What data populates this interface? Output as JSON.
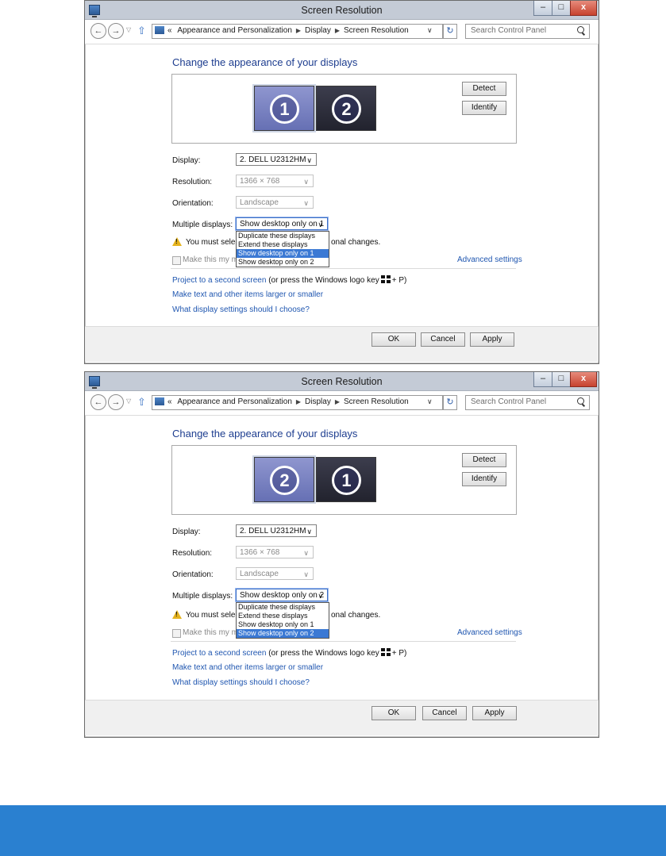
{
  "windows": [
    {
      "title": "Screen Resolution",
      "breadcrumb": [
        "«",
        "Appearance and Personalization",
        "Display",
        "Screen Resolution"
      ],
      "search_placeholder": "Search Control Panel",
      "heading": "Change the appearance of your displays",
      "monitors": [
        {
          "label": "1",
          "style": "blue",
          "selected": true
        },
        {
          "label": "2",
          "style": "dark",
          "selected": false
        }
      ],
      "buttons": {
        "detect": "Detect",
        "identify": "Identify",
        "ok": "OK",
        "cancel": "Cancel",
        "apply": "Apply"
      },
      "display_label": "Display:",
      "display_value": "2. DELL U2312HM",
      "resolution_label": "Resolution:",
      "resolution_value": "1366 × 768",
      "orientation_label": "Orientation:",
      "orientation_value": "Landscape",
      "multiple_label": "Multiple displays:",
      "multiple_value": "Show desktop only on 1",
      "dropdown_options": [
        "Duplicate these displays",
        "Extend these displays",
        "Show desktop only on 1",
        "Show desktop only on 2"
      ],
      "dropdown_selected": 2,
      "warning_text": "You must selec",
      "warning_end": "onal changes.",
      "checkbox_label": "Make this my m",
      "advanced": "Advanced settings",
      "link_project": "Project to a second screen",
      "link_project_rest_a": "(or press the Windows logo key",
      "link_project_rest_b": "+ P)",
      "link_text": "Make text and other items larger or smaller",
      "link_help": "What display settings should I choose?"
    },
    {
      "title": "Screen Resolution",
      "breadcrumb": [
        "«",
        "Appearance and Personalization",
        "Display",
        "Screen Resolution"
      ],
      "search_placeholder": "Search Control Panel",
      "heading": "Change the appearance of your displays",
      "monitors": [
        {
          "label": "2",
          "style": "blue",
          "selected": true
        },
        {
          "label": "1",
          "style": "dark",
          "selected": false
        }
      ],
      "buttons": {
        "detect": "Detect",
        "identify": "Identify",
        "ok": "OK",
        "cancel": "Cancel",
        "apply": "Apply"
      },
      "display_label": "Display:",
      "display_value": "2. DELL U2312HM",
      "resolution_label": "Resolution:",
      "resolution_value": "1366 × 768",
      "orientation_label": "Orientation:",
      "orientation_value": "Landscape",
      "multiple_label": "Multiple displays:",
      "multiple_value": "Show desktop only on 2",
      "dropdown_options": [
        "Duplicate these displays",
        "Extend these displays",
        "Show desktop only on 1",
        "Show desktop only on 2"
      ],
      "dropdown_selected": 3,
      "warning_text": "You must selec",
      "warning_end": "onal changes.",
      "checkbox_label": "Make this my m",
      "advanced": "Advanced settings",
      "link_project": "Project to a second screen",
      "link_project_rest_a": "(or press the Windows logo key",
      "link_project_rest_b": "+ P)",
      "link_text": "Make text and other items larger or smaller",
      "link_help": "What display settings should I choose?"
    }
  ],
  "colors": {
    "banner": "#2a80d0",
    "link": "#1f56b0",
    "heading": "#1d3d8f",
    "selection": "#3b79d4"
  }
}
